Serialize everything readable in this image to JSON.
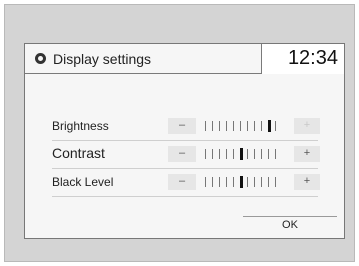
{
  "header": {
    "title": "Display settings",
    "icon": "gear-icon",
    "clock": "12:34"
  },
  "settings": [
    {
      "label": "Brightness",
      "minus": "–",
      "plus": "+",
      "level": 10,
      "steps": 11,
      "plus_enabled": false
    },
    {
      "label": "Contrast",
      "minus": "–",
      "plus": "+",
      "level": 6,
      "steps": 11,
      "plus_enabled": true
    },
    {
      "label": "Black Level",
      "minus": "–",
      "plus": "+",
      "level": 6,
      "steps": 11,
      "plus_enabled": true
    }
  ],
  "ok_button": {
    "label": "OK"
  }
}
